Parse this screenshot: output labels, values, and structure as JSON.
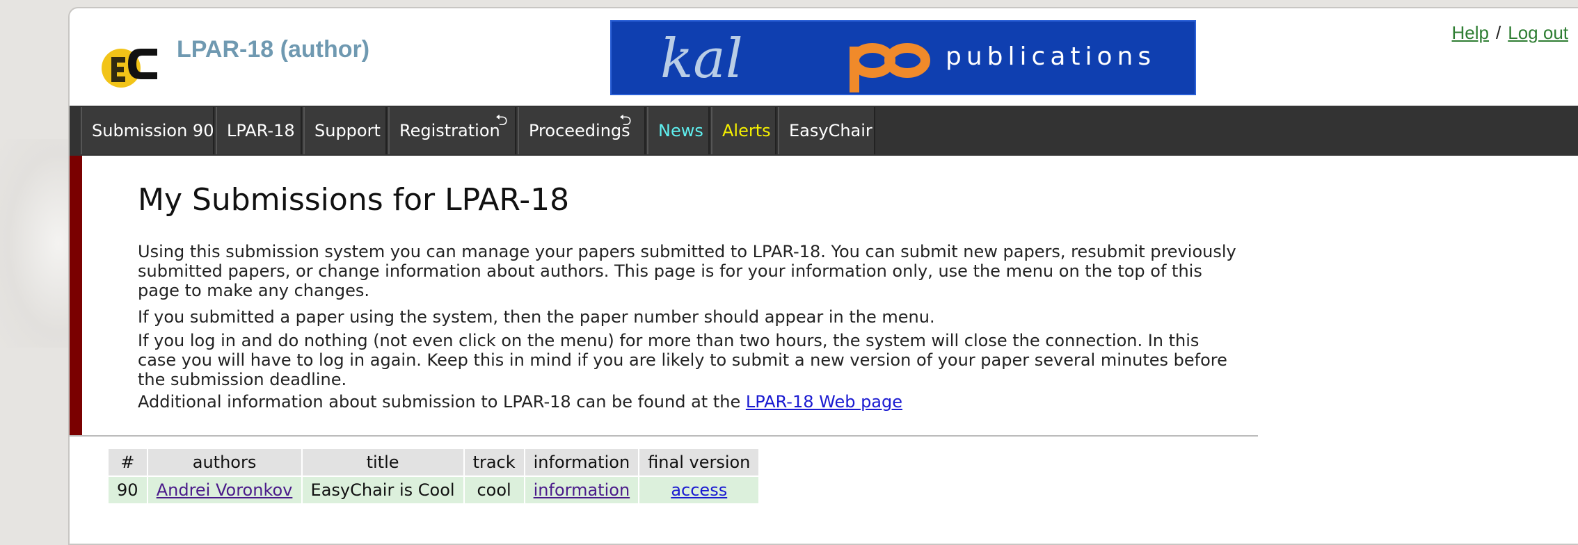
{
  "header": {
    "logo_text": "EC",
    "app_title": "LPAR-18 (author)",
    "banner": {
      "brand": "kalpa",
      "subtitle": "publications"
    },
    "links": {
      "help": "Help",
      "separator": "/",
      "logout": "Log out"
    }
  },
  "nav": {
    "tabs": [
      {
        "label": "Submission 90",
        "color": "#ffffff"
      },
      {
        "label": "LPAR-18",
        "color": "#ffffff"
      },
      {
        "label": "Support",
        "color": "#ffffff"
      },
      {
        "label": "Registration",
        "color": "#ffffff",
        "icon": "return-arrow-icon"
      },
      {
        "label": "Proceedings",
        "color": "#ffffff",
        "icon": "return-arrow-icon"
      },
      {
        "label": "News",
        "color": "#5ff0f0"
      },
      {
        "label": "Alerts",
        "color": "#f5f000"
      },
      {
        "label": "EasyChair",
        "color": "#ffffff"
      }
    ]
  },
  "main": {
    "title": "My Submissions for LPAR-18",
    "paragraphs": [
      "Using this submission system you can manage your papers submitted to LPAR-18. You can submit new papers, resubmit previously submitted papers, or change information about authors. This page is for your information only, use the menu on the top of this page to make any changes.",
      "If you submitted a paper using the system, then the paper number should appear in the menu.",
      "If you log in and do nothing (not even click on the menu) for more than two hours, the system will close the connection. In this case you will have to log in again. Keep this in mind if you are likely to submit a new version of your paper several minutes before the submission deadline."
    ],
    "info_prefix": "Additional information about submission to LPAR-18 can be found at the ",
    "info_link": "LPAR-18 Web page"
  },
  "table": {
    "headers": [
      "#",
      "authors",
      "title",
      "track",
      "information",
      "final version"
    ],
    "rows": [
      {
        "num": "90",
        "authors": "Andrei Voronkov",
        "title": "EasyChair is Cool",
        "track": "cool",
        "information": "information",
        "final_version": "access"
      }
    ]
  },
  "colors": {
    "accent": "#7a0000",
    "nav_bg": "#333333",
    "banner_bg": "#0f3fb0",
    "title_color": "#6f99b1"
  }
}
